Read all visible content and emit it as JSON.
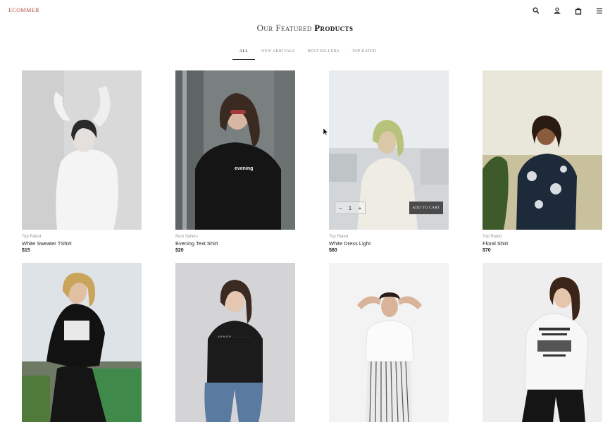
{
  "brand": "ECOMMER",
  "header_icons": [
    "search-icon",
    "user-icon",
    "bag-icon",
    "menu-icon"
  ],
  "heading": {
    "light": "Our Featured",
    "bold": "Products"
  },
  "tabs": [
    "ALL",
    "NEW ARRIVALS",
    "BEST SELLERS",
    "TOP RATED"
  ],
  "products": [
    {
      "category": "Top Rated",
      "name": "White Sweater TShirt",
      "price": "$15"
    },
    {
      "category": "Best Sellers",
      "name": "Evening Text Shirt",
      "price": "$20"
    },
    {
      "category": "Top Rated",
      "name": "White Dress Light",
      "price": "$60"
    },
    {
      "category": "Top Rated",
      "name": "Floral Shirt",
      "price": "$70"
    },
    {
      "category": "",
      "name": "",
      "price": ""
    },
    {
      "category": "",
      "name": "",
      "price": ""
    },
    {
      "category": "",
      "name": "",
      "price": ""
    },
    {
      "category": "",
      "name": "",
      "price": ""
    }
  ],
  "hover_card": {
    "quantity": "1",
    "add_to_cart": "ADD TO CART"
  },
  "colors": {
    "brand": "#b0453e",
    "button": "#4a4a4a",
    "active_tab_underline": "#222222"
  }
}
